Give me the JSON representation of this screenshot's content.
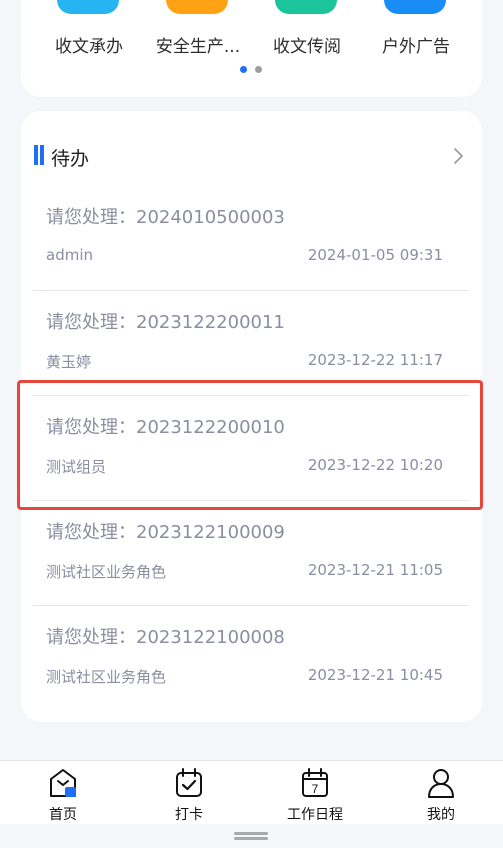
{
  "apps": [
    {
      "label": "收文承办",
      "color": "#26b4f2"
    },
    {
      "label": "安全生产...",
      "color": "#ffa214"
    },
    {
      "label": "收文传阅",
      "color": "#1bc49b"
    },
    {
      "label": "户外广告",
      "color": "#1a8cf5"
    }
  ],
  "pager": {
    "active_color": "#1e6ff5",
    "inactive_color": "#9b9ea6"
  },
  "todo": {
    "title": "待办",
    "items": [
      {
        "title": "请您处理：2024010500003",
        "user": "admin",
        "time": "2024-01-05 09:31"
      },
      {
        "title": "请您处理：2023122200011",
        "user": "黄玉婷",
        "time": "2023-12-22 11:17"
      },
      {
        "title": "请您处理：2023122200010",
        "user": "测试组员",
        "time": "2023-12-22 10:20"
      },
      {
        "title": "请您处理：2023122100009",
        "user": "测试社区业务角色",
        "time": "2023-12-21 11:05"
      },
      {
        "title": "请您处理：2023122100008",
        "user": "测试社区业务角色",
        "time": "2023-12-21 10:45"
      }
    ]
  },
  "tabbar": {
    "tabs": [
      {
        "label": "首页",
        "icon": "home-icon"
      },
      {
        "label": "打卡",
        "icon": "clock-in-icon"
      },
      {
        "label": "工作日程",
        "icon": "calendar-icon",
        "calendar_day": "7"
      },
      {
        "label": "我的",
        "icon": "user-icon"
      }
    ]
  }
}
